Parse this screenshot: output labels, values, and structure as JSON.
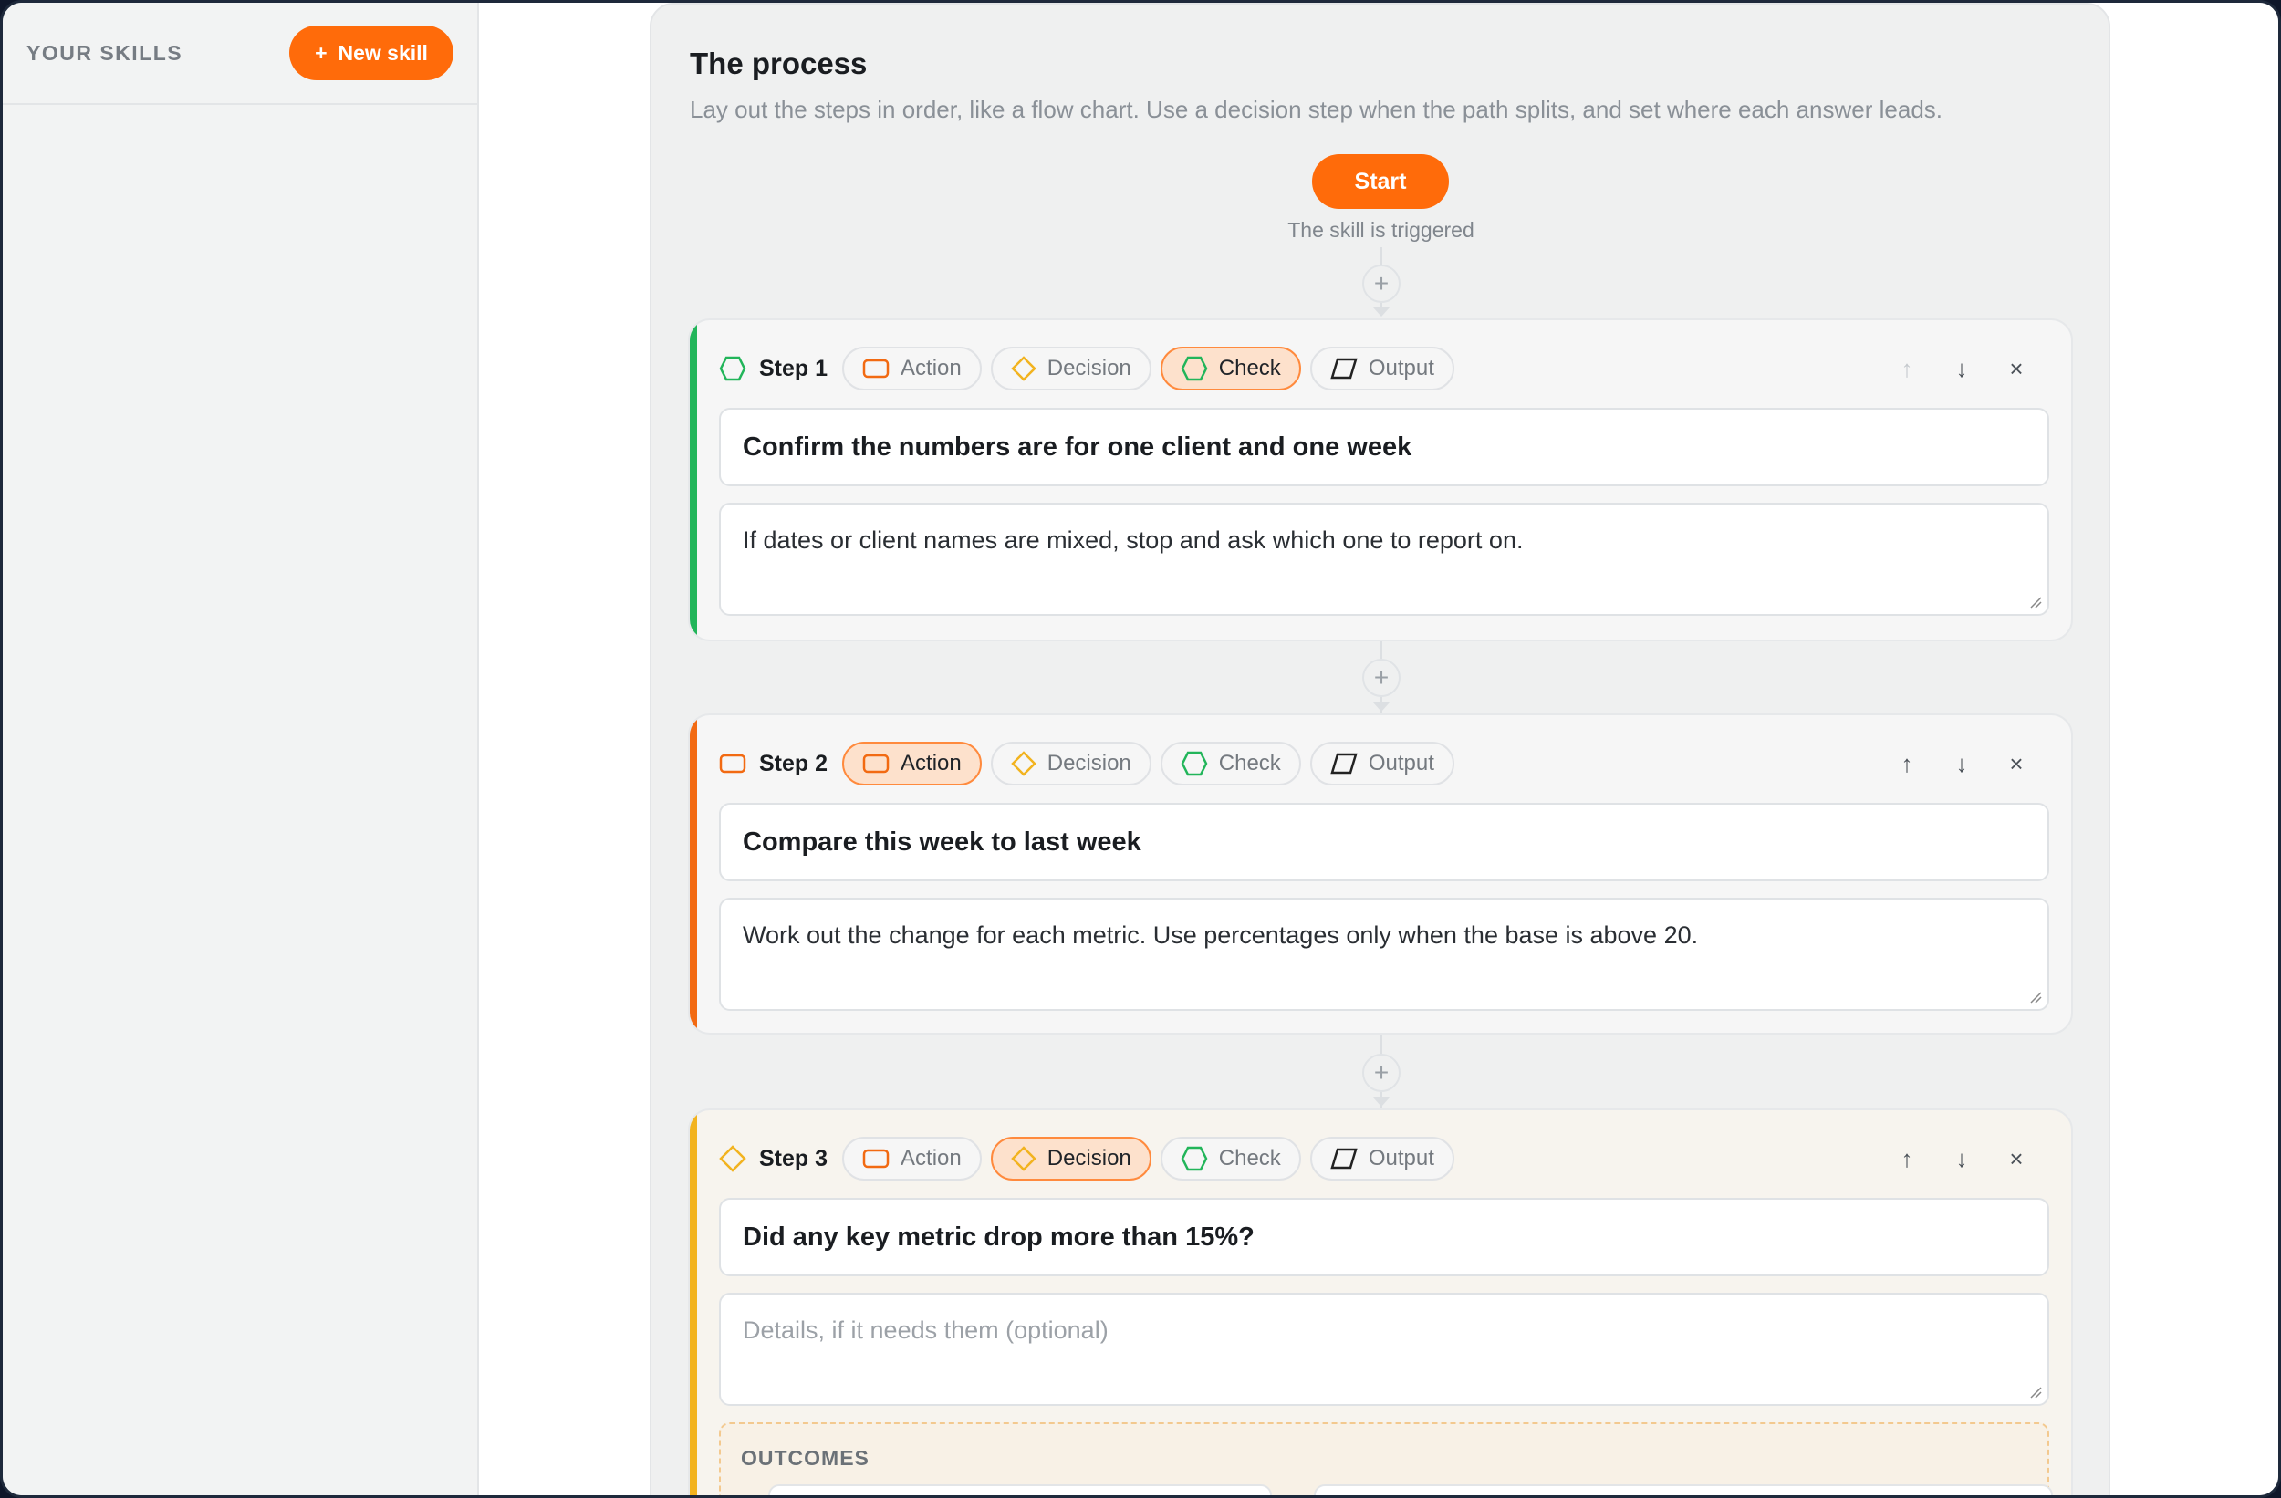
{
  "sidebar": {
    "title": "YOUR SKILLS",
    "new_skill": {
      "icon": "+",
      "label": "New skill"
    }
  },
  "process": {
    "title": "The process",
    "subtitle": "Lay out the steps in order, like a flow chart. Use a decision step when the path splits, and set where each answer leads.",
    "start_label": "Start",
    "start_caption": "The skill is triggered",
    "add_step_symbol": "+"
  },
  "step_types": {
    "action": "Action",
    "decision": "Decision",
    "check": "Check",
    "output": "Output"
  },
  "steps": [
    {
      "label": "Step 1",
      "type": "check",
      "title": "Confirm the numbers are for one client and one week",
      "description": "If dates or client names are mixed, stop and ask which one to report on."
    },
    {
      "label": "Step 2",
      "type": "action",
      "title": "Compare this week to last week",
      "description": "Work out the change for each metric. Use percentages only when the base is above 20."
    },
    {
      "label": "Step 3",
      "type": "decision",
      "title": "Did any key metric drop more than 15%?",
      "description_placeholder": "Details, if it needs them (optional)",
      "outcomes_label": "OUTCOMES"
    }
  ],
  "step_controls": {
    "up": "↑",
    "down": "↓",
    "remove": "×"
  },
  "colors": {
    "accent": "#ff6b0a",
    "check": "#22b55a",
    "action": "#f26a12",
    "decision": "#f2b31f"
  }
}
